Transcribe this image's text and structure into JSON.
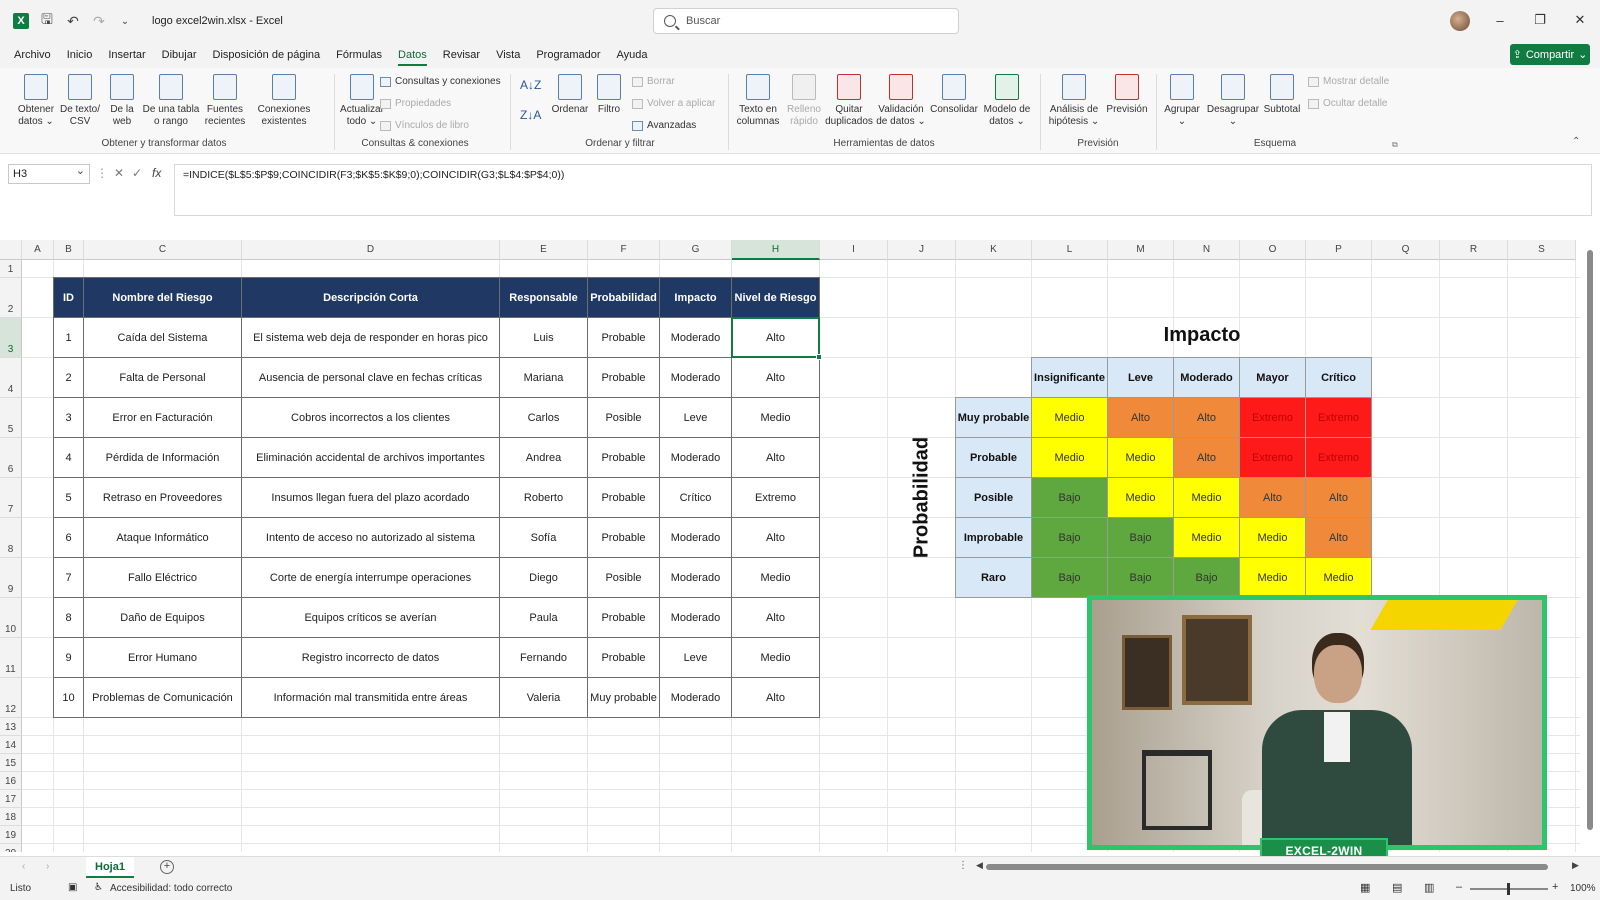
{
  "titlebar": {
    "doc_title": "logo excel2win.xlsx  -  Excel",
    "search_placeholder": "Buscar",
    "app_icon": "X"
  },
  "menu": {
    "tabs": [
      "Archivo",
      "Inicio",
      "Insertar",
      "Dibujar",
      "Disposición de página",
      "Fórmulas",
      "Datos",
      "Revisar",
      "Vista",
      "Programador",
      "Ayuda"
    ],
    "active": "Datos",
    "share_label": "Compartir"
  },
  "ribbon": {
    "obtener": {
      "b1": "Obtener datos ⌄",
      "b2": "De texto/ CSV",
      "b3": "De la web",
      "b4": "De una tabla o rango",
      "b5": "Fuentes recientes",
      "b6": "Conexiones existentes",
      "label": "Obtener y transformar datos"
    },
    "consultas": {
      "actualizar": "Actualizar todo ⌄",
      "s1": "Consultas y conexiones",
      "s2": "Propiedades",
      "s3": "Vínculos de libro",
      "label": "Consultas & conexiones"
    },
    "ordenar": {
      "ordenar": "Ordenar",
      "filtro": "Filtro",
      "s1": "Borrar",
      "s2": "Volver a aplicar",
      "s3": "Avanzadas",
      "label": "Ordenar y filtrar"
    },
    "herramientas": {
      "b1": "Texto en columnas",
      "b2": "Relleno rápido",
      "b3": "Quitar duplicados",
      "b4": "Validación de datos ⌄",
      "b5": "Consolidar",
      "b6": "Modelo de datos ⌄",
      "label": "Herramientas de datos"
    },
    "prevision": {
      "b1": "Análisis de hipótesis ⌄",
      "b2": "Previsión",
      "label": "Previsión"
    },
    "esquema": {
      "b1": "Agrupar ⌄",
      "b2": "Desagrupar ⌄",
      "b3": "Subtotal",
      "s1": "Mostrar detalle",
      "s2": "Ocultar detalle",
      "label": "Esquema"
    }
  },
  "formula_bar": {
    "namebox": "H3",
    "formula": "=INDICE($L$5:$P$9;COINCIDIR(F3;$K$5:$K$9;0);COINCIDIR(G3;$L$4:$P$4;0))"
  },
  "columns": [
    "A",
    "B",
    "C",
    "D",
    "E",
    "F",
    "G",
    "H",
    "I",
    "J",
    "K",
    "L",
    "M",
    "N",
    "O",
    "P",
    "Q",
    "R",
    "S"
  ],
  "rows": [
    "1",
    "2",
    "3",
    "4",
    "5",
    "6",
    "7",
    "8",
    "9",
    "10",
    "11",
    "12",
    "13",
    "14",
    "15",
    "16",
    "17",
    "18",
    "19",
    "20"
  ],
  "risk_table": {
    "headers": [
      "ID",
      "Nombre del Riesgo",
      "Descripción Corta",
      "Responsable",
      "Probabilidad",
      "Impacto",
      "Nivel de Riesgo"
    ],
    "rows": [
      [
        "1",
        "Caída del Sistema",
        "El sistema web deja de responder en horas pico",
        "Luis",
        "Probable",
        "Moderado",
        "Alto"
      ],
      [
        "2",
        "Falta de Personal",
        "Ausencia de personal clave en fechas críticas",
        "Mariana",
        "Probable",
        "Moderado",
        "Alto"
      ],
      [
        "3",
        "Error en Facturación",
        "Cobros incorrectos a los clientes",
        "Carlos",
        "Posible",
        "Leve",
        "Medio"
      ],
      [
        "4",
        "Pérdida de Información",
        "Eliminación accidental de archivos importantes",
        "Andrea",
        "Probable",
        "Moderado",
        "Alto"
      ],
      [
        "5",
        "Retraso en Proveedores",
        "Insumos llegan fuera del plazo acordado",
        "Roberto",
        "Probable",
        "Crítico",
        "Extremo"
      ],
      [
        "6",
        "Ataque Informático",
        "Intento de acceso no autorizado al sistema",
        "Sofía",
        "Probable",
        "Moderado",
        "Alto"
      ],
      [
        "7",
        "Fallo Eléctrico",
        "Corte de energía interrumpe operaciones",
        "Diego",
        "Posible",
        "Moderado",
        "Medio"
      ],
      [
        "8",
        "Daño de Equipos",
        "Equipos críticos se averían",
        "Paula",
        "Probable",
        "Moderado",
        "Alto"
      ],
      [
        "9",
        "Error Humano",
        "Registro incorrecto de datos",
        "Fernando",
        "Probable",
        "Leve",
        "Medio"
      ],
      [
        "10",
        "Problemas de Comunicación",
        "Información mal transmitida entre áreas",
        "Valeria",
        "Muy probable",
        "Moderado",
        "Alto"
      ]
    ]
  },
  "matrix": {
    "title_impact": "Impacto",
    "title_prob": "Probabilidad",
    "impact_levels": [
      "Insignificante",
      "Leve",
      "Moderado",
      "Mayor",
      "Crítico"
    ],
    "prob_levels": [
      "Muy probable",
      "Probable",
      "Posible",
      "Improbable",
      "Raro"
    ],
    "values": [
      [
        "Medio",
        "Alto",
        "Alto",
        "Extremo",
        "Extremo"
      ],
      [
        "Medio",
        "Medio",
        "Alto",
        "Extremo",
        "Extremo"
      ],
      [
        "Bajo",
        "Medio",
        "Medio",
        "Alto",
        "Alto"
      ],
      [
        "Bajo",
        "Bajo",
        "Medio",
        "Medio",
        "Alto"
      ],
      [
        "Bajo",
        "Bajo",
        "Bajo",
        "Medio",
        "Medio"
      ]
    ],
    "colors": {
      "Bajo": "#5fa83f",
      "Medio": "#ffff00",
      "Alto": "#f08a3a",
      "Extremo": "#ff1a1a"
    }
  },
  "video": {
    "logo_text": "EXCEL-2WIN"
  },
  "sheet": {
    "tab": "Hoja1",
    "add_icon": "+"
  },
  "status": {
    "ready": "Listo",
    "accessibility": "Accesibilidad: todo correcto",
    "zoom": "100%"
  }
}
